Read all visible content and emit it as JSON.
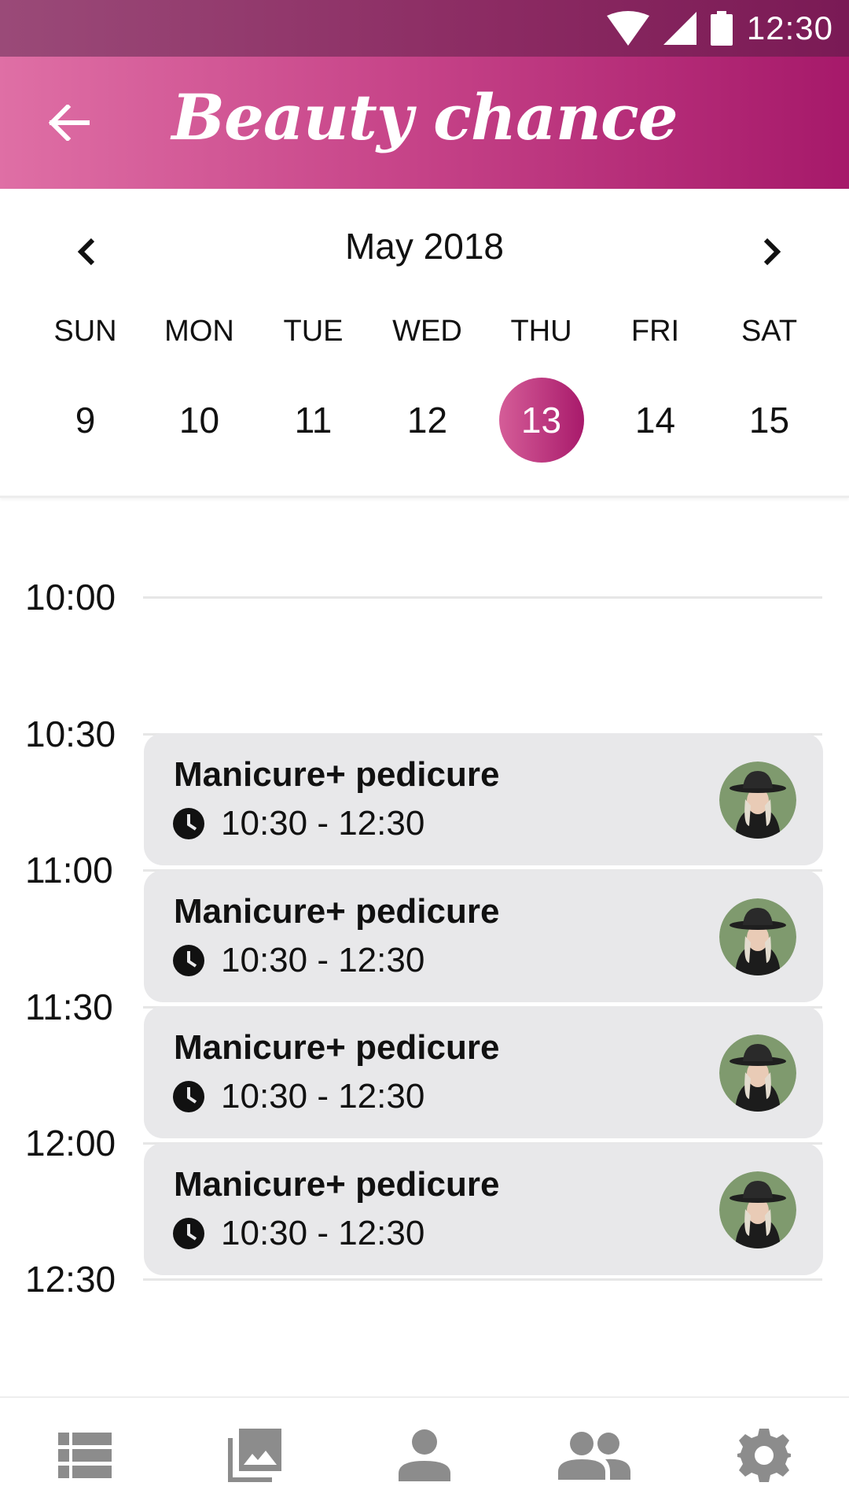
{
  "status_bar": {
    "time": "12:30"
  },
  "app_bar": {
    "title": "Beauty chance"
  },
  "calendar": {
    "month": "May 2018",
    "weekdays": [
      "SUN",
      "MON",
      "TUE",
      "WED",
      "THU",
      "FRI",
      "SAT"
    ],
    "days": [
      "9",
      "10",
      "11",
      "12",
      "13",
      "14",
      "15"
    ],
    "selected_day": "13"
  },
  "timeline": {
    "slots": [
      "10:00",
      "10:30",
      "11:00",
      "11:30",
      "12:00",
      "12:30"
    ],
    "appointments": [
      {
        "title": "Manicure+ pedicure",
        "time": "10:30 - 12:30"
      },
      {
        "title": "Manicure+ pedicure",
        "time": "10:30 - 12:30"
      },
      {
        "title": "Manicure+ pedicure",
        "time": "10:30 - 12:30"
      },
      {
        "title": "Manicure+ pedicure",
        "time": "10:30 - 12:30"
      }
    ]
  },
  "bottom_nav": {
    "items": [
      "list-icon",
      "photo-library-icon",
      "person-icon",
      "people-icon",
      "settings-icon"
    ]
  },
  "colors": {
    "accent": "#b32c78",
    "accent_light": "#df6fa5",
    "card_bg": "#e8e8ea",
    "nav_icon": "#8c8c8c"
  }
}
